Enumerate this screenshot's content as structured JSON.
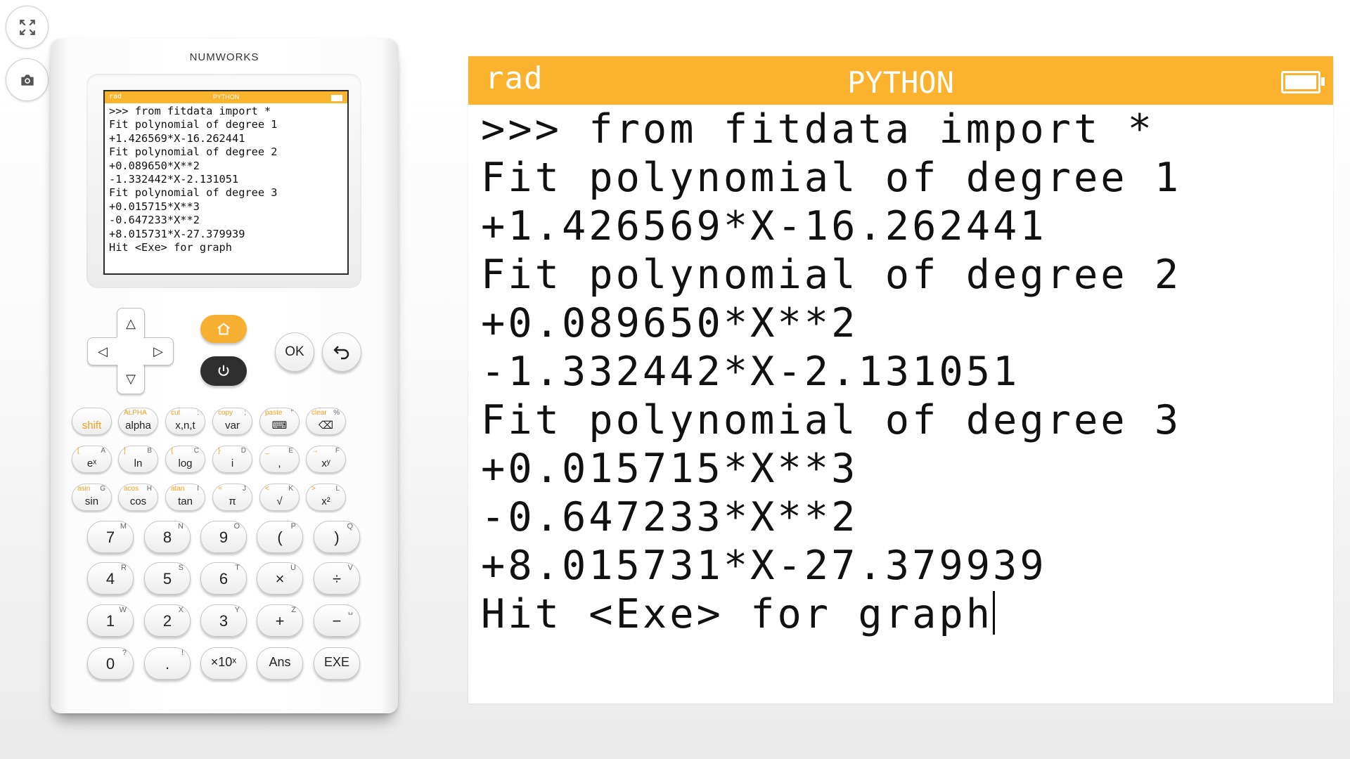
{
  "sidebar": {
    "fullscreen_icon": "fullscreen-icon",
    "screenshot_icon": "camera-icon"
  },
  "calculator": {
    "brand": "NUMWORKS",
    "home_icon": "home-icon",
    "power_icon": "power-icon",
    "ok_label": "OK",
    "back_icon": "back-arrow-icon",
    "dpad": {
      "up": "△",
      "down": "▽",
      "left": "◁",
      "right": "▷"
    },
    "fn_rows": [
      [
        {
          "main": "shift",
          "top": "",
          "alt": ""
        },
        {
          "main": "alpha",
          "top": "ALPHA",
          "alt": ""
        },
        {
          "main": "x,n,t",
          "top": "cut",
          "alt": ":"
        },
        {
          "main": "var",
          "top": "copy",
          "alt": ";"
        },
        {
          "main": "⌨",
          "top": "paste",
          "alt": "\""
        },
        {
          "main": "⌫",
          "top": "clear",
          "alt": "%"
        }
      ],
      [
        {
          "main": "eˣ",
          "top": "[",
          "alt": "A"
        },
        {
          "main": "ln",
          "top": "]",
          "alt": "B"
        },
        {
          "main": "log",
          "top": "{",
          "alt": "C"
        },
        {
          "main": "i",
          "top": "}",
          "alt": "D"
        },
        {
          "main": ",",
          "top": "_",
          "alt": "E"
        },
        {
          "main": "xʸ",
          "top": "→",
          "alt": "F"
        }
      ],
      [
        {
          "main": "sin",
          "top": "asin",
          "alt": "G"
        },
        {
          "main": "cos",
          "top": "acos",
          "alt": "H"
        },
        {
          "main": "tan",
          "top": "atan",
          "alt": "I"
        },
        {
          "main": "π",
          "top": "=",
          "alt": "J"
        },
        {
          "main": "√",
          "top": "<",
          "alt": "K"
        },
        {
          "main": "x²",
          "top": ">",
          "alt": "L"
        }
      ]
    ],
    "num_rows": [
      [
        {
          "main": "7",
          "alt": "M"
        },
        {
          "main": "8",
          "alt": "N"
        },
        {
          "main": "9",
          "alt": "O"
        },
        {
          "main": "(",
          "alt": "P"
        },
        {
          "main": ")",
          "alt": "Q"
        }
      ],
      [
        {
          "main": "4",
          "alt": "R"
        },
        {
          "main": "5",
          "alt": "S"
        },
        {
          "main": "6",
          "alt": "T"
        },
        {
          "main": "×",
          "alt": "U"
        },
        {
          "main": "÷",
          "alt": "V"
        }
      ],
      [
        {
          "main": "1",
          "alt": "W"
        },
        {
          "main": "2",
          "alt": "X"
        },
        {
          "main": "3",
          "alt": "Y"
        },
        {
          "main": "+",
          "alt": "Z"
        },
        {
          "main": "−",
          "alt": "␣"
        }
      ],
      [
        {
          "main": "0",
          "alt": "?"
        },
        {
          "main": ".",
          "alt": "!"
        },
        {
          "main": "×10ˣ",
          "alt": ""
        },
        {
          "main": "Ans",
          "alt": ""
        },
        {
          "main": "EXE",
          "alt": ""
        }
      ]
    ]
  },
  "screen": {
    "angle_mode": "rad",
    "app_title": "PYTHON",
    "battery_icon": "battery-full-icon",
    "lines": [
      ">>> from fitdata import *",
      "Fit polynomial of degree 1",
      "+1.426569*X-16.262441",
      "Fit polynomial of degree 2",
      "+0.089650*X**2",
      "-1.332442*X-2.131051",
      "Fit polynomial of degree 3",
      "+0.015715*X**3",
      "-0.647233*X**2",
      "+8.015731*X-27.379939",
      "Hit <Exe> for graph"
    ]
  }
}
